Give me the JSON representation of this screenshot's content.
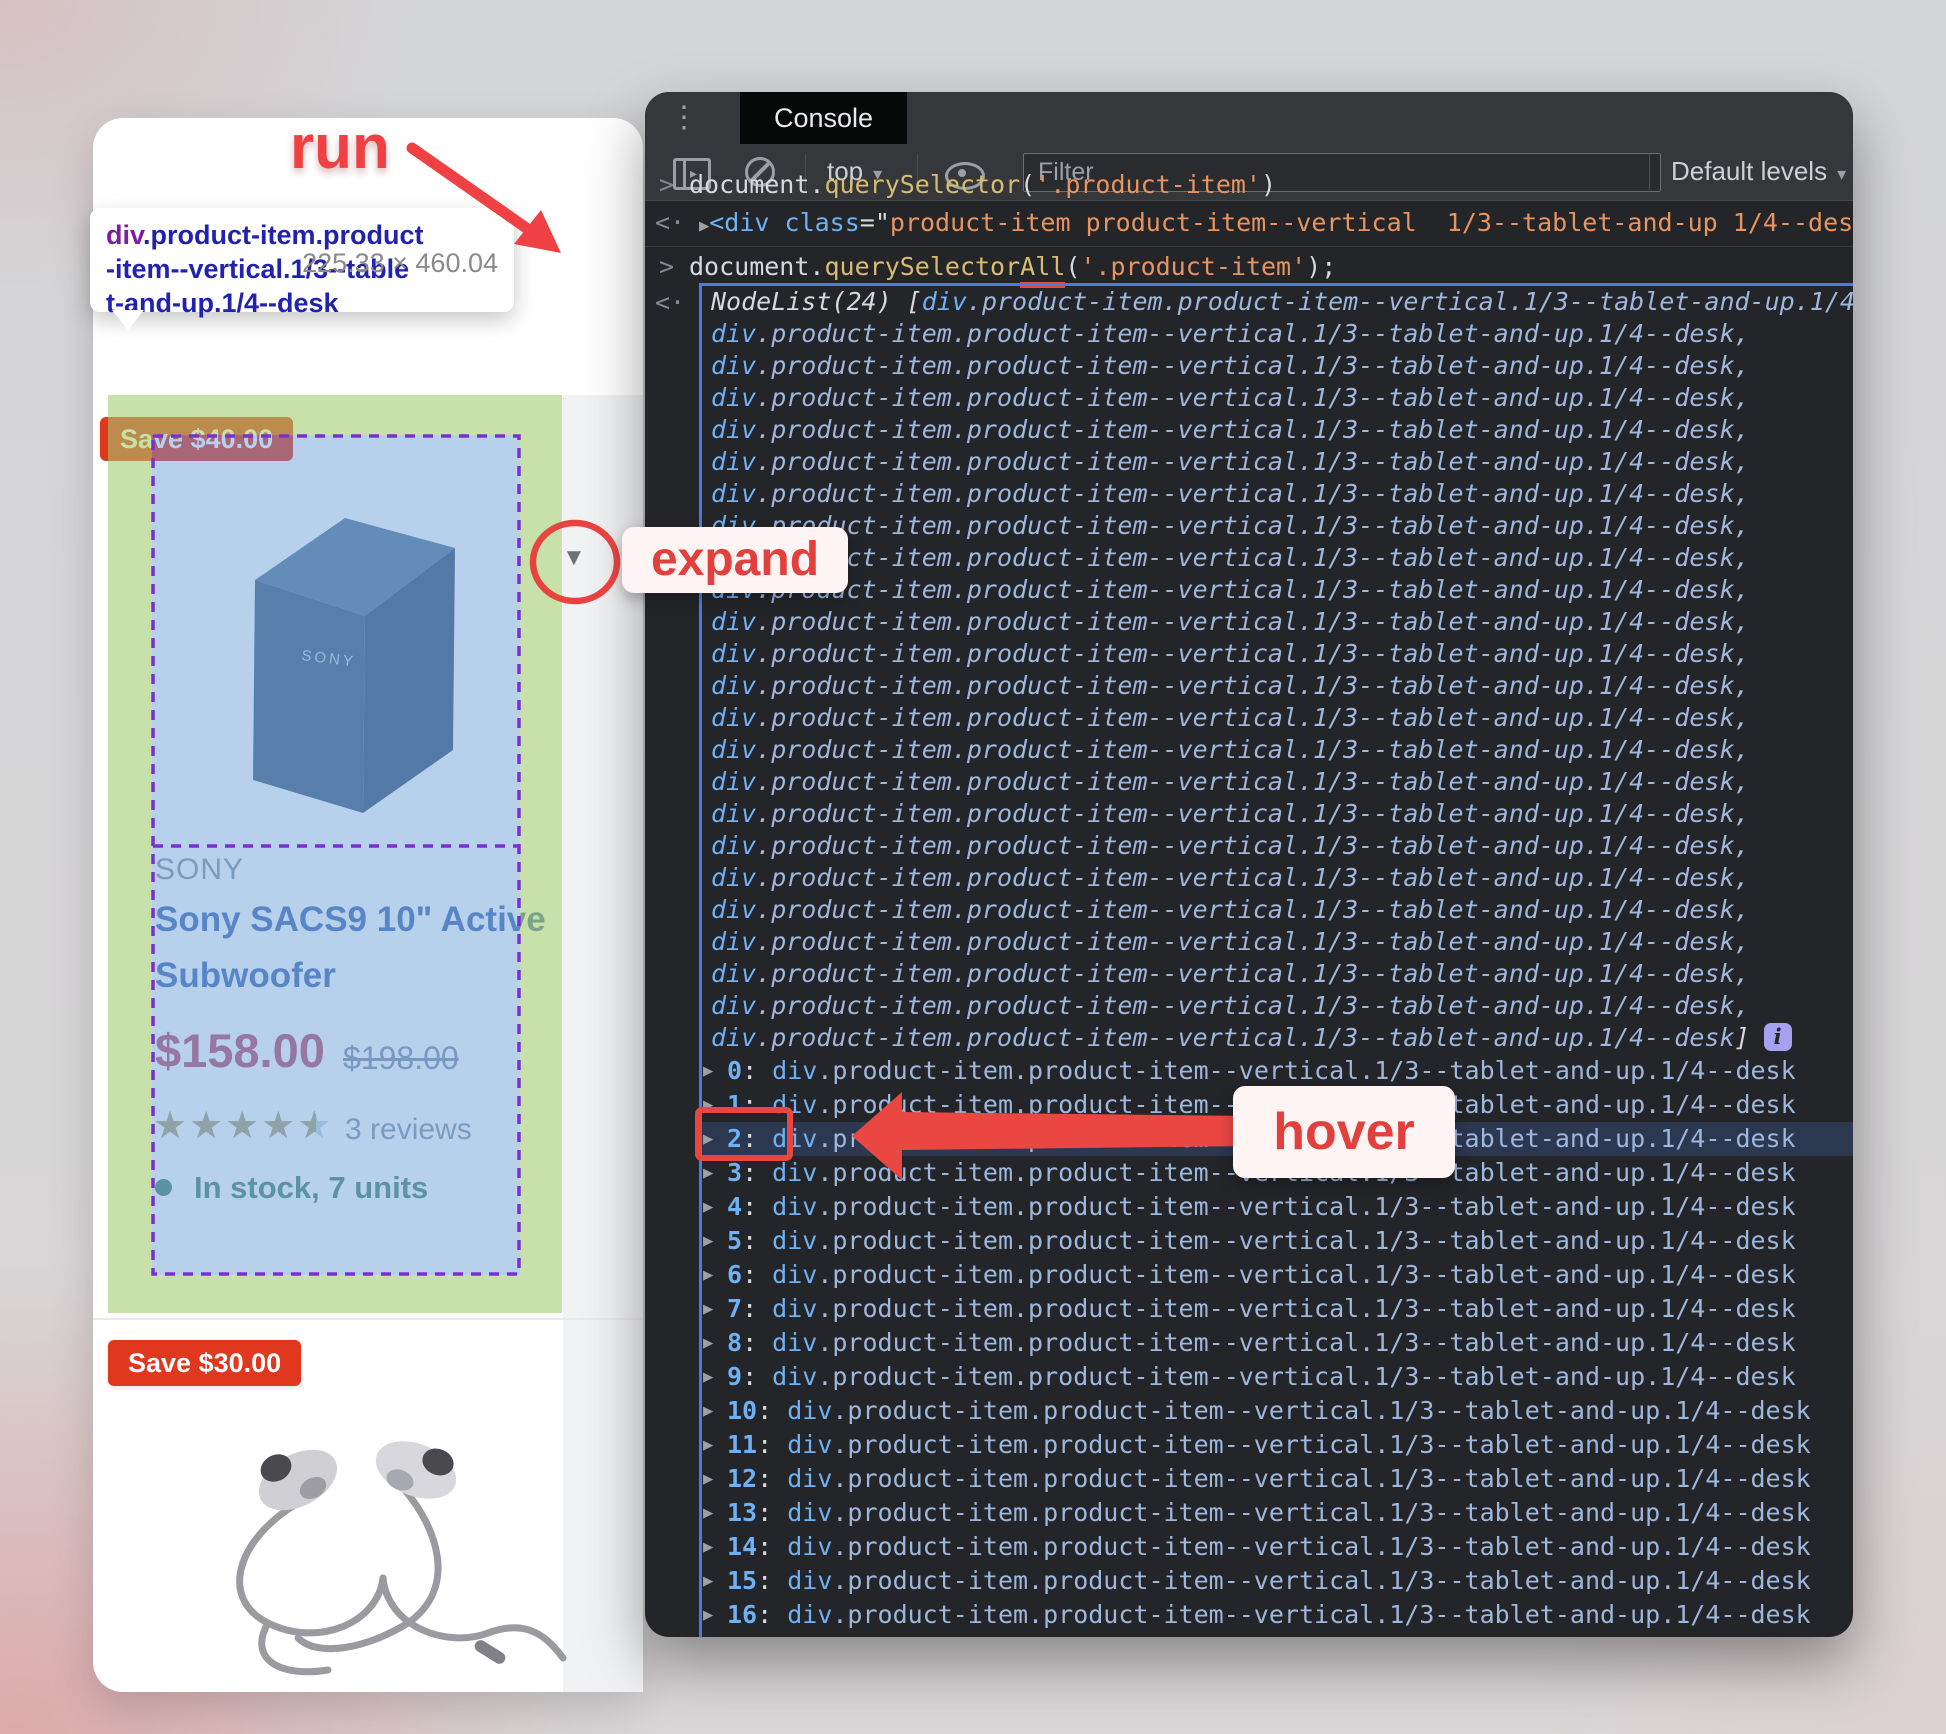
{
  "page": {
    "product1": {
      "badge": "Save $40.00",
      "brand": "SONY",
      "speaker_logo": "SONY",
      "title_line1": "Sony SACS9 10\" Active",
      "title_line2": "Subwoofer",
      "price": "$158.00",
      "old_price": "$198.00",
      "rating": "4.5 of 5 stars",
      "reviews": "3 reviews",
      "stock": "In stock, 7 units"
    },
    "product2": {
      "badge": "Save $30.00"
    }
  },
  "inspect_tooltip": {
    "tag": "div",
    "selector_line1": ".product-item.product",
    "selector_line2": "-item--vertical.1/3--table",
    "selector_line3": "t-and-up.1/4--desk",
    "dimensions": "225.33 × 460.04"
  },
  "annotations": {
    "run": "run",
    "expand": "expand",
    "hover": "hover"
  },
  "devtools": {
    "tab": "Console",
    "toolbar": {
      "context": "top",
      "caret": "▾",
      "filter_placeholder": "Filter",
      "levels": "Default levels"
    },
    "prompt": ">",
    "return_arrow": "<·",
    "expander_closed": "▶",
    "expander_open": "▼",
    "command1": {
      "object": "document",
      "dot": ".",
      "method": "querySelector",
      "open": "(",
      "arg": "'.product-item'",
      "close": ")"
    },
    "result1": {
      "tag_open": "<div",
      "space": " ",
      "attr": "class",
      "eq": "=\"",
      "value": "product-item product-item--vertical  1/3--tablet-and-up 1/4--des"
    },
    "command2": {
      "object": "document",
      "dot": ".",
      "method": "querySelector",
      "method_suffix": "All",
      "open": "(",
      "arg": "'.product-item'",
      "close": ");"
    },
    "nodelist": {
      "label": "NodeList(24)",
      "open_bracket": " [",
      "item_div": "div",
      "item_rest": ".product-item.product-item--vertical.1/3--tablet-and-up.1/4--desk",
      "comma": ",",
      "close_bracket": "]",
      "info_icon": "i",
      "middle_line_count": 22
    },
    "indexed": {
      "count": 17,
      "separator": ": ",
      "highlight_index": 2
    }
  }
}
